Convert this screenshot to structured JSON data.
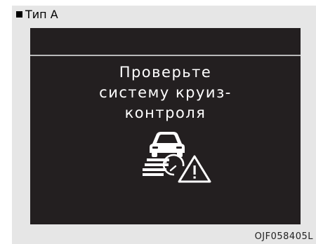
{
  "header": {
    "type_label": "Тип А"
  },
  "screen": {
    "message_lines": [
      "Проверьте",
      "систему круиз-",
      "контроля"
    ],
    "icon": "cruise-control-warning-icon"
  },
  "footer": {
    "code": "OJF058405L"
  },
  "colors": {
    "frame_bg": "#e6e6e6",
    "screen_bg": "#231f20",
    "text": "#ffffff"
  }
}
